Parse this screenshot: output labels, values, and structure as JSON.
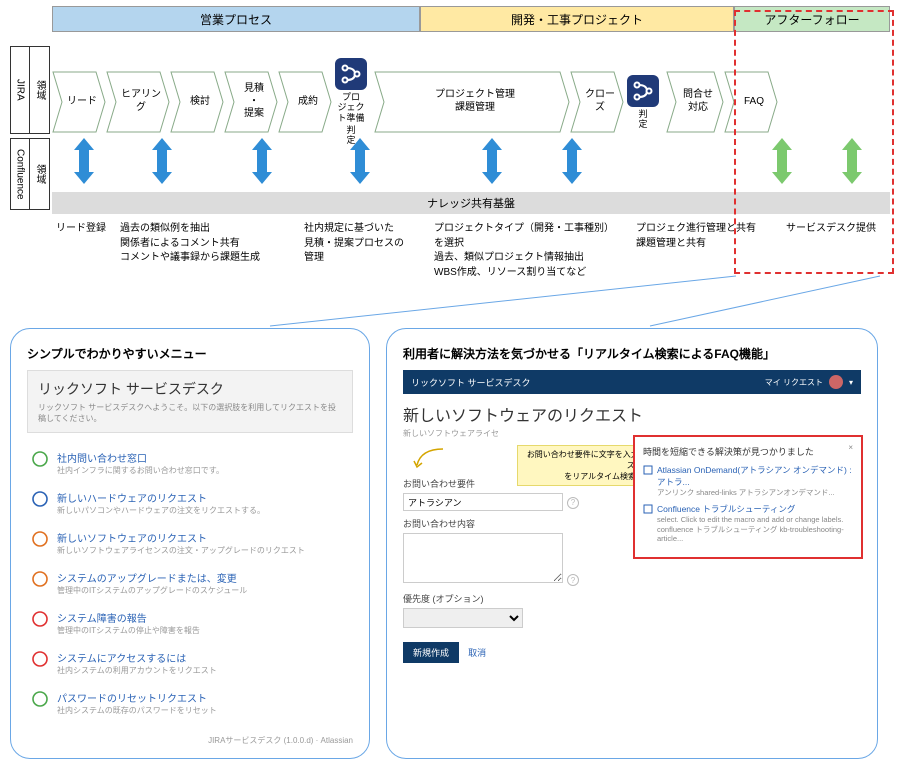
{
  "phases": {
    "sales": "営業プロセス",
    "dev": "開発・工事プロジェクト",
    "after": "アフターフォロー"
  },
  "row_labels": {
    "jira_axis": "JIRA",
    "jira_area": "領域",
    "conf_axis": "Confluence",
    "conf_area": "領域"
  },
  "chevrons": {
    "lead": "リード",
    "hearing": "ヒアリング",
    "review": "検討",
    "estimate": "見積\n・\n提案",
    "contract": "成約",
    "proj_prep": "プロ\nジェク\nト準備",
    "judge": "判\n定",
    "pm": "プロジェクト管理\n課題管理",
    "close": "クロー\nズ",
    "judge2": "判\n定",
    "inquiry": "問合せ\n対応",
    "faq": "FAQ"
  },
  "kb": "ナレッジ共有基盤",
  "notes": {
    "c1": "リード登録",
    "c2": "過去の類似例を抽出\n関係者によるコメント共有\nコメントや議事録から課題生成",
    "c3": "社内規定に基づいた\n見積・提案プロセスの\n管理",
    "c4": "プロジェクトタイプ（開発・工事種別）\nを選択\n過去、類似プロジェクト情報抽出\nWBS作成、リソース割り当てなど",
    "c5": "プロジェク進行管理と共有\n課題管理と共有",
    "c6": "サービスデスク提供"
  },
  "left_callout": {
    "title": "シンプルでわかりやすいメニュー",
    "head_title": "リックソフト サービスデスク",
    "head_sub": "リックソフト サービスデスクへようこそ。以下の選択肢を利用してリクエストを投稿してください。",
    "items": [
      {
        "t": "社内問い合わせ窓口",
        "s": "社内インフラに関するお問い合わせ窓口です。",
        "c": "#4aa74a"
      },
      {
        "t": "新しいハードウェアのリクエスト",
        "s": "新しいパソコンやハードウェアの注文をリクエストする。",
        "c": "#2a62b5"
      },
      {
        "t": "新しいソフトウェアのリクエスト",
        "s": "新しいソフトウェアライセンスの注文・アップグレードのリクエスト",
        "c": "#e07020"
      },
      {
        "t": "システムのアップグレードまたは、変更",
        "s": "管理中のITシステムのアップグレードのスケジュール",
        "c": "#e07020"
      },
      {
        "t": "システム障害の報告",
        "s": "管理中のITシステムの停止や障害を報告",
        "c": "#e03030"
      },
      {
        "t": "システムにアクセスするには",
        "s": "社内システムの利用アカウントをリクエスト",
        "c": "#e03030"
      },
      {
        "t": "パスワードのリセットリクエスト",
        "s": "社内システムの既存のパスワードをリセット",
        "c": "#4aa74a"
      }
    ],
    "foot": "JIRAサービスデスク (1.0.0.d) · Atlassian"
  },
  "right_callout": {
    "title": "利用者に解決方法を気づかせる「リアルタイム検索によるFAQ機能」",
    "bar_left": "リックソフト サービスデスク",
    "bar_right": "マイ リクエスト",
    "page_title": "新しいソフトウェアのリクエスト",
    "page_sub": "新しいソフトウェアライセ",
    "hint1": "お問い合わせ要件に文字を入力すると、FAQ(ナレッジベース)",
    "hint2": "をリアルタイム検索して解決策を表示",
    "f_subject_label": "お問い合わせ要件",
    "f_subject_value": "アトラシアン",
    "f_body_label": "お問い合わせ内容",
    "f_priority_label": "優先度 (オプション)",
    "btn_create": "新規作成",
    "btn_cancel": "取消",
    "faq_head": "時間を短縮できる解決策が見つかりました",
    "faq_items": [
      {
        "t": "Atlassian OnDemand(アトラシアン オンデマンド) : アトラ...",
        "s": "アンリンク shared-links アトラシアンオンデマンド..."
      },
      {
        "t": "Confluence トラブルシューティング",
        "s": "select. Click to edit the macro and add or change labels. confluence トラブルシューティング kb-troubleshooting-article..."
      }
    ]
  }
}
